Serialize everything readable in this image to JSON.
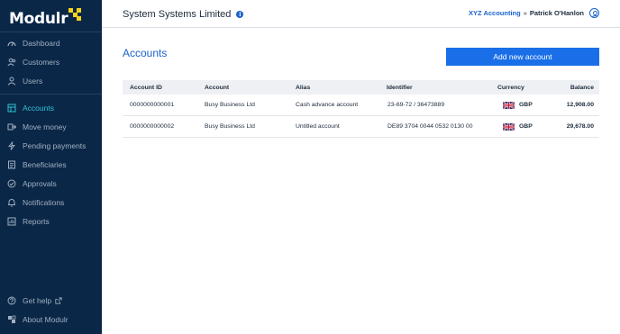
{
  "brand": {
    "logo_text": "Modulr"
  },
  "sidebar": {
    "items": [
      {
        "label": "Dashboard",
        "icon": "dashboard-icon"
      },
      {
        "label": "Customers",
        "icon": "customers-icon"
      },
      {
        "label": "Users",
        "icon": "users-icon"
      },
      {
        "label": "Accounts",
        "icon": "accounts-icon",
        "active": true
      },
      {
        "label": "Move money",
        "icon": "move-money-icon"
      },
      {
        "label": "Pending payments",
        "icon": "lightning-icon"
      },
      {
        "label": "Beneficiaries",
        "icon": "beneficiaries-icon"
      },
      {
        "label": "Approvals",
        "icon": "check-circle-icon"
      },
      {
        "label": "Notifications",
        "icon": "bell-icon"
      },
      {
        "label": "Reports",
        "icon": "reports-icon"
      }
    ],
    "bottom": [
      {
        "label": "Get help",
        "icon": "help-icon"
      },
      {
        "label": "About Modulr",
        "icon": "modulr-icon"
      }
    ]
  },
  "header": {
    "company": "System Systems Limited",
    "org": "XYZ Accounting",
    "separator": "»",
    "user": "Patrick O'Hanlon"
  },
  "main": {
    "title": "Accounts",
    "add_button": "Add new account",
    "columns": [
      "Account ID",
      "Account",
      "Alias",
      "Identifier",
      "Currency",
      "Balance"
    ],
    "rows": [
      {
        "account_id": "0000000000001",
        "account": "Busy Business Ltd",
        "alias": "Cash advance account",
        "identifier": "23-69-72 / 36473889",
        "currency": "GBP",
        "balance": "12,908.00"
      },
      {
        "account_id": "0000000000002",
        "account": "Busy Business Ltd",
        "alias": "Untitled account",
        "identifier": "DE89 3704 0044 0532 0130 00",
        "currency": "GBP",
        "balance": "29,678.00"
      }
    ]
  },
  "colors": {
    "sidebar_bg": "#0b2747",
    "accent_blue": "#1a63c9",
    "active_cyan": "#2fc2d6",
    "logo_yellow": "#f5d21f",
    "button_blue": "#1a6fe8"
  }
}
